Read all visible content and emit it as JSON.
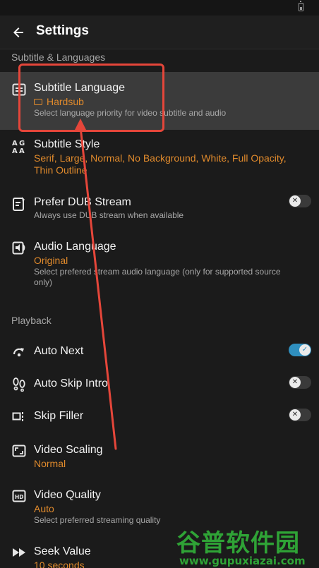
{
  "header": {
    "title": "Settings"
  },
  "sections": {
    "subtitle": "Subtitle & Languages",
    "playback": "Playback"
  },
  "rows": {
    "subtitle_language": {
      "title": "Subtitle Language",
      "value": "Hardsub",
      "desc": "Select language priority for video subtitle and audio",
      "icon": "subtitles-icon"
    },
    "subtitle_style": {
      "title": "Subtitle Style",
      "value": "Serif, Large, Normal, No Background, White, Full Opacity, Thin Outline",
      "icon": "text-style-icon"
    },
    "prefer_dub": {
      "title": "Prefer DUB Stream",
      "desc": "Always use DUB stream when available",
      "enabled": false,
      "icon": "dub-icon"
    },
    "audio_language": {
      "title": "Audio Language",
      "value": "Original",
      "desc": "Select prefered stream audio language (only for supported source only)",
      "icon": "audio-icon"
    },
    "auto_next": {
      "title": "Auto Next",
      "enabled": true,
      "icon": "auto-next-icon"
    },
    "auto_skip_intro": {
      "title": "Auto Skip Intro",
      "enabled": false,
      "icon": "footprints-icon"
    },
    "skip_filler": {
      "title": "Skip Filler",
      "enabled": false,
      "icon": "skip-filler-icon"
    },
    "video_scaling": {
      "title": "Video Scaling",
      "value": "Normal",
      "icon": "aspect-ratio-icon"
    },
    "video_quality": {
      "title": "Video Quality",
      "value": "Auto",
      "desc": "Select preferred streaming quality",
      "icon": "hd-icon"
    },
    "seek_value": {
      "title": "Seek Value",
      "value": "10 seconds",
      "icon": "fast-forward-icon"
    }
  },
  "watermark": {
    "brand": "谷普软件园",
    "url": "www.gupuxiazai.com"
  },
  "colors": {
    "accent": "#e08a2c",
    "toggle_on": "#2f8fbf",
    "annotation": "#e5463a",
    "watermark": "#2fa336"
  }
}
